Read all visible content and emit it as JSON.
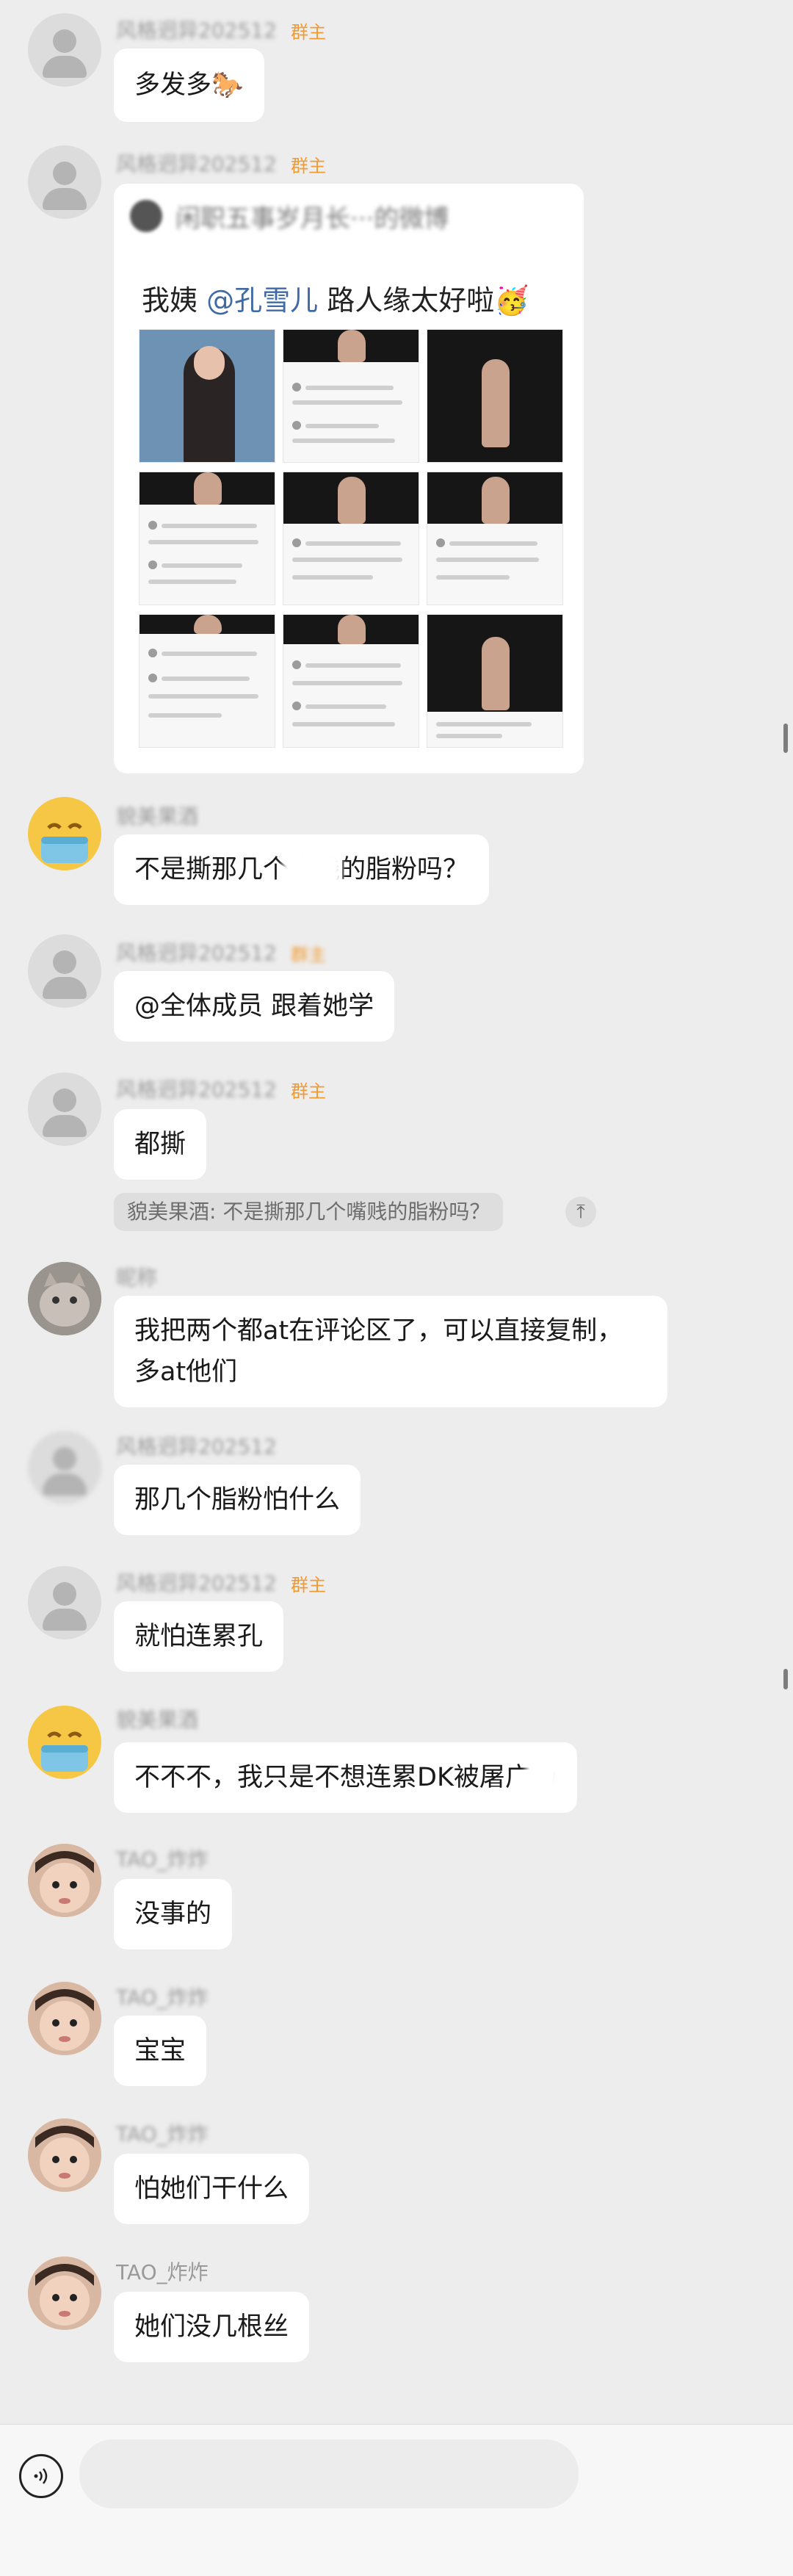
{
  "role_label": "群主",
  "messages": [
    {
      "sender": "风格迥异202512",
      "text": "多发多🐎"
    },
    {
      "sender": "风格迥异202512",
      "card": {
        "header": "闲职五事岁月长···的微博",
        "title_prefix": "我姨",
        "mention": "@孔雪儿",
        "title_suffix": "路人缘太好啦🥳"
      }
    },
    {
      "sender": "貌美果酒",
      "text": "不是撕那几个嘴贱的脂粉吗？"
    },
    {
      "sender": "风格迥异202512",
      "text": "@全体成员 跟着她学"
    },
    {
      "sender": "风格迥异202512",
      "text": "都撕",
      "quote": "貌美果酒: 不是撕那几个嘴贱的脂粉吗？",
      "quote_btn": "⤒"
    },
    {
      "sender": "昵称",
      "text": "我把两个都at在评论区了，可以直接复制，多at他们"
    },
    {
      "sender": "风格迥异202512",
      "text": "那几个脂粉怕什么"
    },
    {
      "sender": "风格迥异202512",
      "text": "就怕连累孔"
    },
    {
      "sender": "貌美果酒",
      "text": "不不不，我只是不想连累DK被屠广场"
    },
    {
      "sender": "TAO_炸炸",
      "text": "没事的"
    },
    {
      "sender": "TAO_炸炸",
      "text": "宝宝"
    },
    {
      "sender": "TAO_炸炸",
      "text": "怕她们干什么"
    },
    {
      "sender": "TAO_炸炸",
      "text": "她们没几根丝"
    }
  ],
  "input": {
    "placeholder": ""
  },
  "icons": {
    "voice": "voice-icon"
  }
}
